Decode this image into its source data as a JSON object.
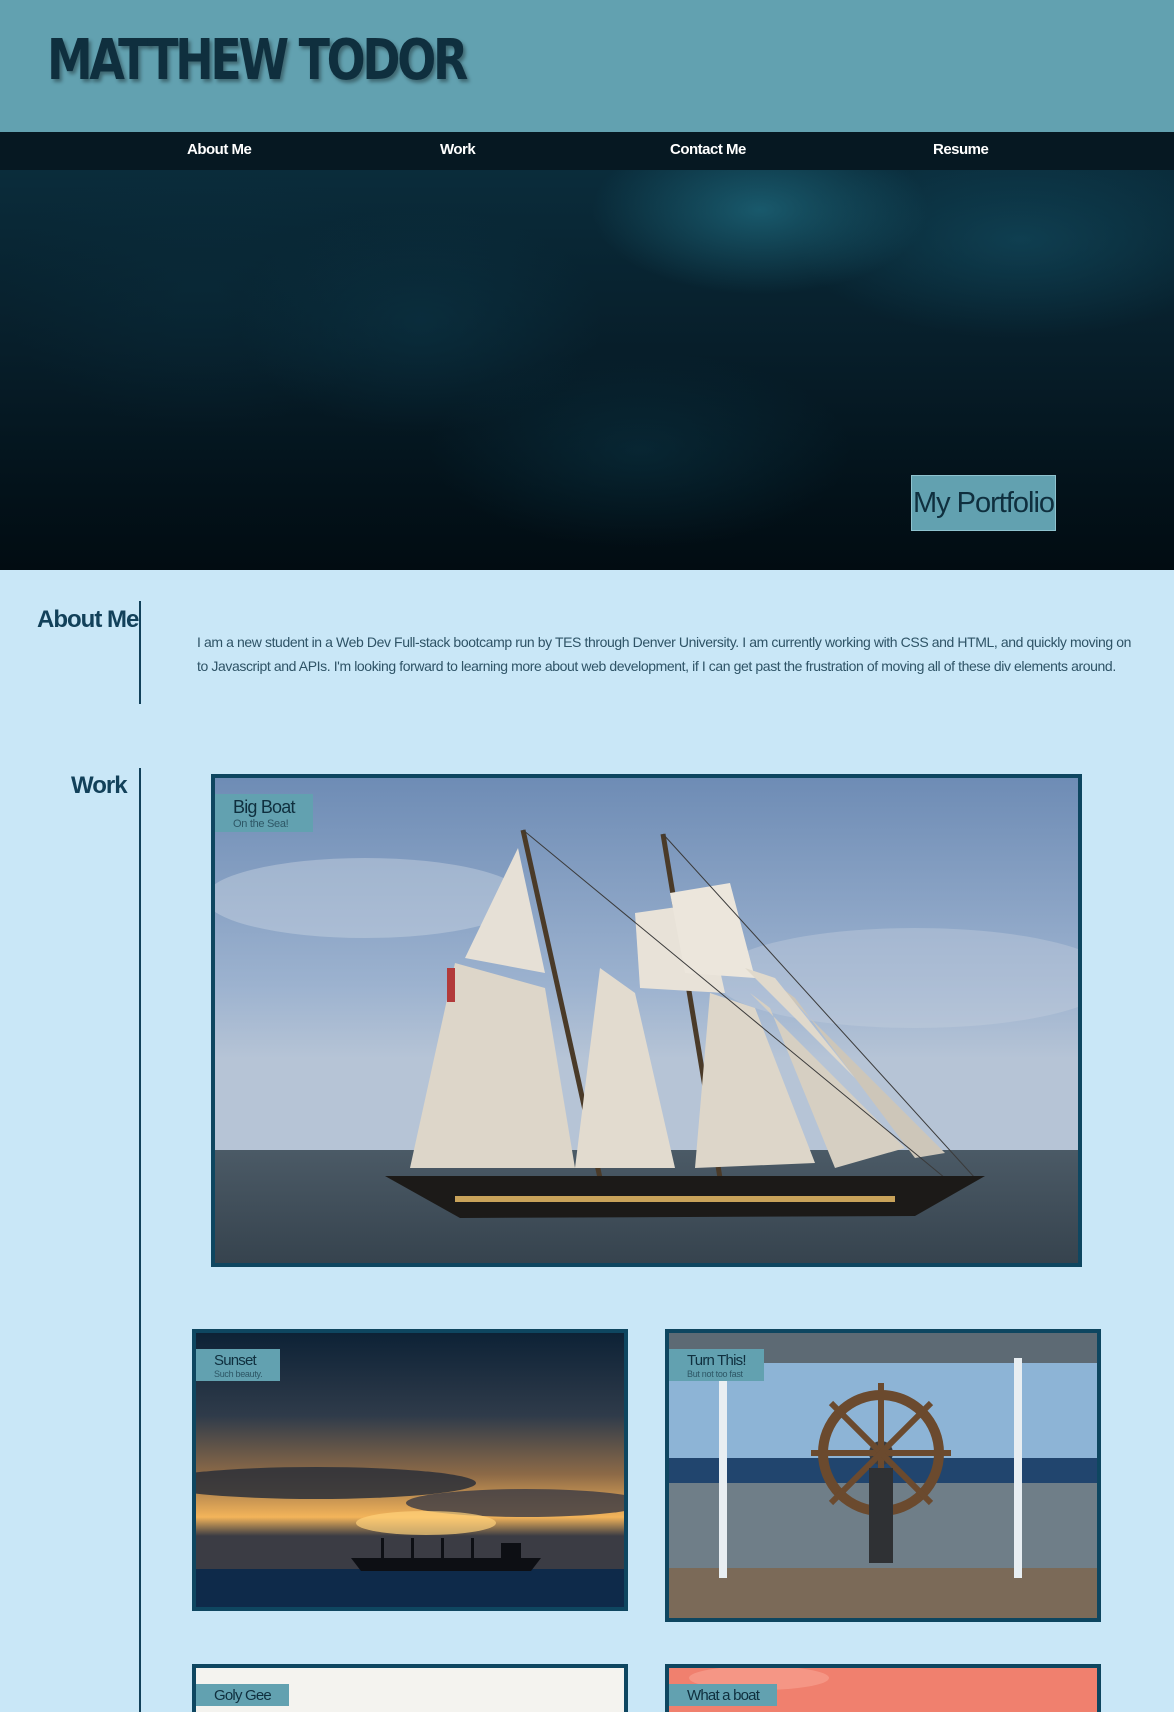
{
  "header": {
    "title": "MATTHEW TODOR"
  },
  "nav": {
    "items": [
      "About Me",
      "Work",
      "Contact Me",
      "Resume"
    ]
  },
  "hero": {
    "badge": "My Portfolio"
  },
  "about": {
    "heading": "About Me",
    "text": "I am a new student in a Web Dev Full-stack bootcamp run by TES through Denver University. I am currently working with CSS and HTML, and quickly moving on to Javascript and APIs. I'm looking forward to learning more about web development, if I can get past the frustration of moving all of these div elements around."
  },
  "work": {
    "heading": "Work",
    "cards": [
      {
        "title": "Big Boat",
        "subtitle": "On the Sea!"
      },
      {
        "title": "Sunset",
        "subtitle": "Such beauty."
      },
      {
        "title": "Turn This!",
        "subtitle": "But not too fast"
      },
      {
        "title": "Goly Gee",
        "subtitle": ""
      },
      {
        "title": "What a boat",
        "subtitle": ""
      }
    ]
  },
  "colors": {
    "header_bg": "#62a1b0",
    "nav_bg": "#061822",
    "page_bg": "#c9e7f7",
    "accent_dark": "#12415a"
  }
}
